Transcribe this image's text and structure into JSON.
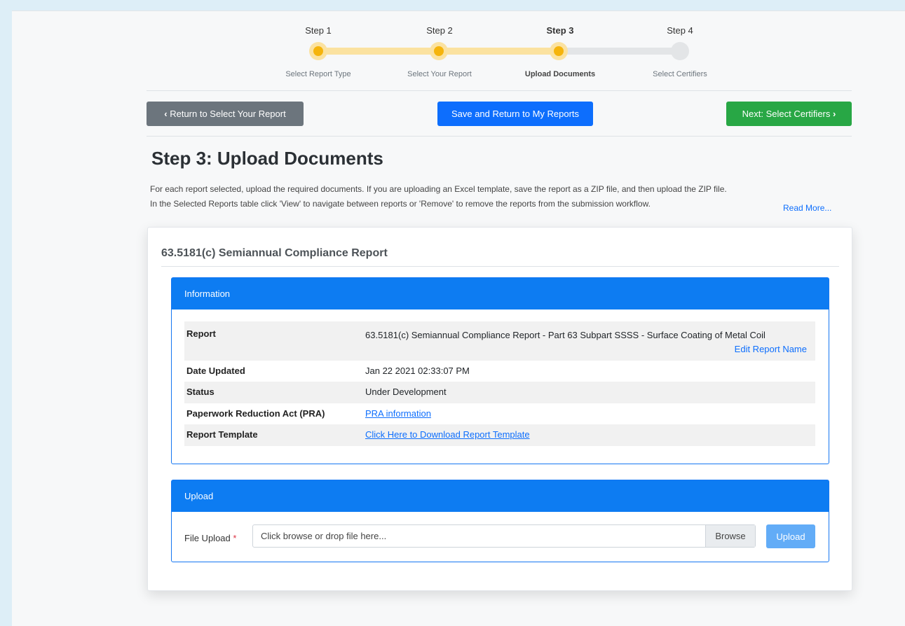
{
  "steps": [
    {
      "title": "Step 1",
      "subtitle": "Select Report Type"
    },
    {
      "title": "Step 2",
      "subtitle": "Select Your Report"
    },
    {
      "title": "Step 3",
      "subtitle": "Upload Documents"
    },
    {
      "title": "Step 4",
      "subtitle": "Select Certifiers"
    }
  ],
  "current_step": 3,
  "nav": {
    "back_label": "Return to Select Your Report",
    "save_label": "Save and Return to My Reports",
    "next_label": "Next: Select Certifiers"
  },
  "page_title": "Step 3: Upload Documents",
  "intro": {
    "line1": "For each report selected, upload the required documents. If you are uploading an Excel template, save the report as a ZIP file, and then upload the ZIP file.",
    "line2": "In the Selected Reports table click 'View' to navigate between reports or 'Remove' to remove the reports from the submission workflow.",
    "read_more": "Read More..."
  },
  "card": {
    "title": "63.5181(c) Semiannual Compliance Report"
  },
  "info_panel": {
    "heading": "Information",
    "rows": [
      {
        "label": "Report",
        "value": "63.5181(c) Semiannual Compliance Report - Part 63 Subpart SSSS - Surface Coating of Metal Coil",
        "action": "Edit Report Name"
      },
      {
        "label": "Date Updated",
        "value": "Jan 22 2021 02:33:07 PM"
      },
      {
        "label": "Status",
        "value": "Under Development"
      },
      {
        "label": "Paperwork Reduction Act (PRA)",
        "value": "PRA information"
      },
      {
        "label": "Report Template",
        "value": "Click Here to Download Report Template"
      }
    ]
  },
  "upload_panel": {
    "heading": "Upload",
    "field_label": "File Upload",
    "required_mark": "*",
    "placeholder": "Click browse or drop file here...",
    "browse_label": "Browse",
    "upload_label": "Upload"
  }
}
